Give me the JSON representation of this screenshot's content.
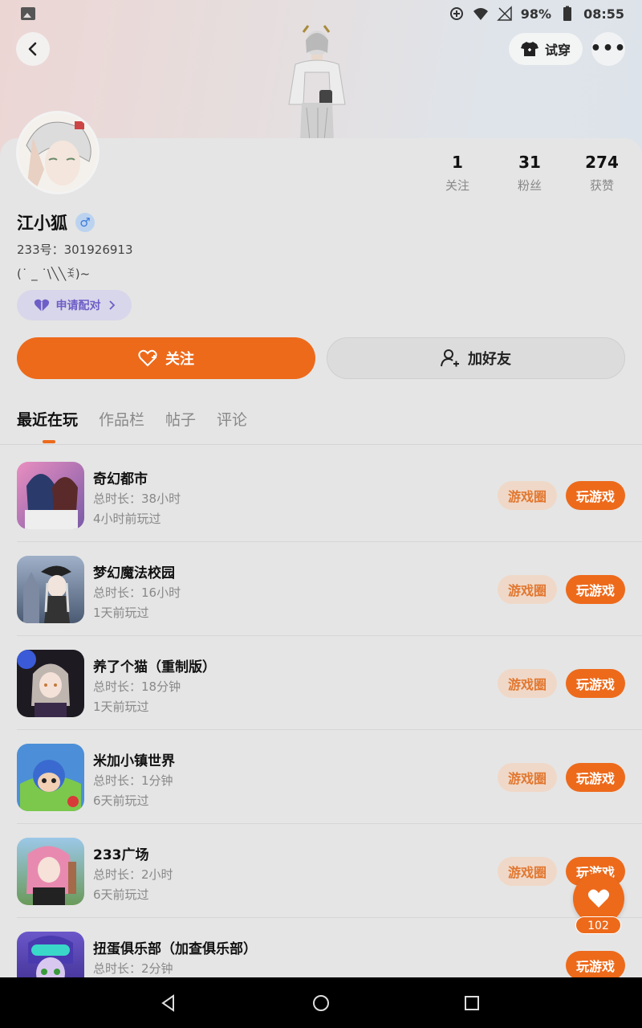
{
  "status_bar": {
    "battery": "98%",
    "time": "08:55"
  },
  "header": {
    "try_on_label": "试穿"
  },
  "profile": {
    "name": "江小狐",
    "gender_symbol": "♂",
    "uid": "233号：301926913",
    "signature": "(˙ _ ˙\\╲╲ꉂ)~",
    "pair_label": "申请配对",
    "follow_label": "关注",
    "add_friend_label": "加好友"
  },
  "stats": [
    {
      "num": "1",
      "label": "关注"
    },
    {
      "num": "31",
      "label": "粉丝"
    },
    {
      "num": "274",
      "label": "获赞"
    }
  ],
  "tabs": [
    "最近在玩",
    "作品栏",
    "帖子",
    "评论"
  ],
  "games": [
    {
      "title": "奇幻都市",
      "duration": "总时长：38小时",
      "last": "4小时前玩过",
      "circle": "游戏圈",
      "play": "玩游戏",
      "color": "#e98fc0"
    },
    {
      "title": "梦幻魔法校园",
      "duration": "总时长：16小时",
      "last": "1天前玩过",
      "circle": "游戏圈",
      "play": "玩游戏",
      "color": "#7c8ea8"
    },
    {
      "title": "养了个猫（重制版）",
      "duration": "总时长：18分钟",
      "last": "1天前玩过",
      "circle": "游戏圈",
      "play": "玩游戏",
      "color": "#2b2430"
    },
    {
      "title": "米加小镇世界",
      "duration": "总时长：1分钟",
      "last": "6天前玩过",
      "circle": "游戏圈",
      "play": "玩游戏",
      "color": "#4c8fd8"
    },
    {
      "title": "233广场",
      "duration": "总时长：2小时",
      "last": "6天前玩过",
      "circle": "游戏圈",
      "play": "玩游戏",
      "color": "#d88fb0"
    },
    {
      "title": "扭蛋俱乐部（加查俱乐部）",
      "duration": "总时长：2分钟",
      "last": "",
      "circle": "",
      "play": "玩游戏",
      "color": "#6b57c9"
    }
  ],
  "like_count": "102",
  "colors": {
    "accent": "#ed6a1b",
    "pair_text": "#6d5ec7"
  }
}
